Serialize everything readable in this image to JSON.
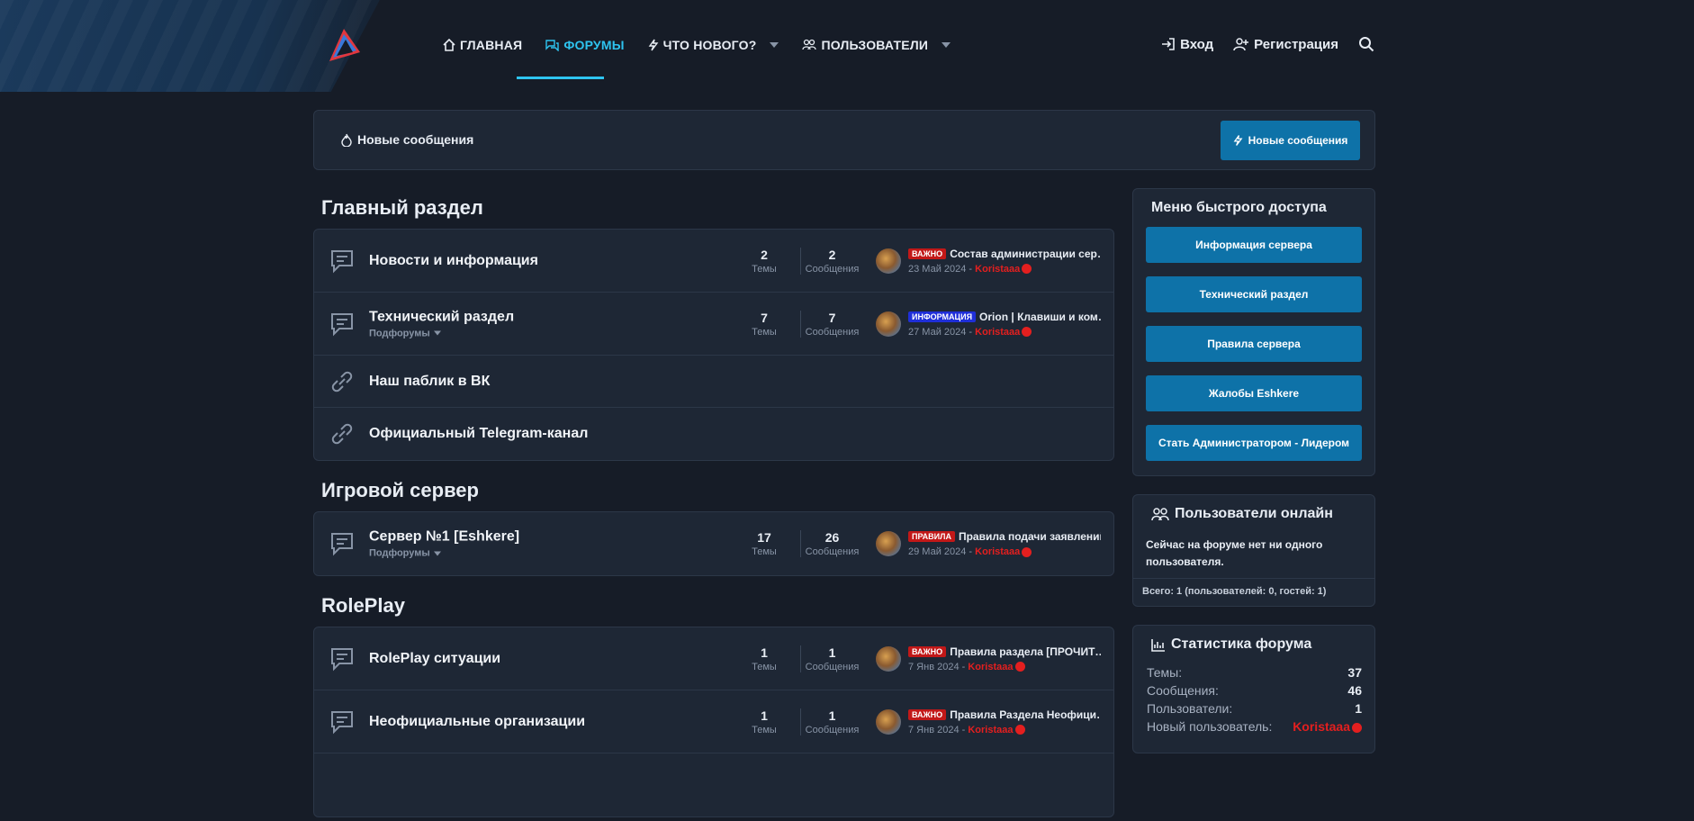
{
  "colors": {
    "accent": "#2ec4f0",
    "button": "#0e72a8",
    "username": "#e41f1f",
    "badge_important": "#c21818",
    "badge_info": "#1f2fd8"
  },
  "nav": {
    "items": [
      {
        "label": "ГЛАВНАЯ",
        "icon": "home-icon"
      },
      {
        "label": "ФОРУМЫ",
        "icon": "chat-icon"
      },
      {
        "label": "ЧТО НОВОГО?",
        "icon": "bolt-icon"
      },
      {
        "label": "ПОЛЬЗОВАТЕЛИ",
        "icon": "users-icon"
      }
    ],
    "login": "Вход",
    "register": "Регистрация"
  },
  "newbar": {
    "label": "Новые сообщения",
    "button": "Новые сообщения"
  },
  "categories": [
    {
      "title": "Главный раздел",
      "forums": [
        {
          "name": "Новости и информация",
          "sub": "",
          "threads": "2",
          "threads_label": "Темы",
          "posts": "2",
          "posts_label": "Сообщения",
          "badge": "ВАЖНО",
          "last_title": "Состав администрации сер…",
          "last_date": "23 Май 2024",
          "last_user": "Koristaaa"
        },
        {
          "name": "Технический раздел",
          "sub": "Подфорумы",
          "threads": "7",
          "threads_label": "Темы",
          "posts": "7",
          "posts_label": "Сообщения",
          "badge": "ИНФОРМАЦИЯ",
          "last_title": "Orion | Клавиши и ком…",
          "last_date": "27 Май 2024",
          "last_user": "Koristaaa"
        },
        {
          "name": "Наш паблик в ВК"
        },
        {
          "name": "Официальный Telegram-канал"
        }
      ]
    },
    {
      "title": "Игровой сервер",
      "forums": [
        {
          "name": "Сервер №1 [Eshkere]",
          "sub": "Подфорумы",
          "threads": "17",
          "threads_label": "Темы",
          "posts": "26",
          "posts_label": "Сообщения",
          "badge": "ПРАВИЛА",
          "last_title": "Правила подачи заявлений",
          "last_date": "29 Май 2024",
          "last_user": "Koristaaa"
        }
      ]
    },
    {
      "title": "RolePlay",
      "forums": [
        {
          "name": "RolePlay ситуации",
          "threads": "1",
          "threads_label": "Темы",
          "posts": "1",
          "posts_label": "Сообщения",
          "badge": "ВАЖНО",
          "last_title": "Правила раздела [ПРОЧИТ…",
          "last_date": "7 Янв 2024",
          "last_user": "Koristaaa"
        },
        {
          "name": "Неофициальные организации",
          "threads": "1",
          "threads_label": "Темы",
          "posts": "1",
          "posts_label": "Сообщения",
          "badge": "ВАЖНО",
          "last_title": "Правила Раздела Неофици…",
          "last_date": "7 Янв 2024",
          "last_user": "Koristaaa"
        }
      ]
    }
  ],
  "quick": {
    "title": "Меню быстрого доступа",
    "buttons": [
      "Информация сервера",
      "Технический раздел",
      "Правила сервера",
      "Жалобы Eshkere",
      "Стать Администратором - Лидером"
    ]
  },
  "online": {
    "title": "Пользователи онлайн",
    "text": "Сейчас на форуме нет ни одного пользователя.",
    "footer": "Всего: 1 (пользователей: 0, гостей: 1)"
  },
  "stats": {
    "title": "Статистика форума",
    "rows": [
      {
        "k": "Темы:",
        "v": "37"
      },
      {
        "k": "Сообщения:",
        "v": "46"
      },
      {
        "k": "Пользователи:",
        "v": "1"
      },
      {
        "k": "Новый пользователь:",
        "v": "Koristaaa"
      }
    ]
  }
}
